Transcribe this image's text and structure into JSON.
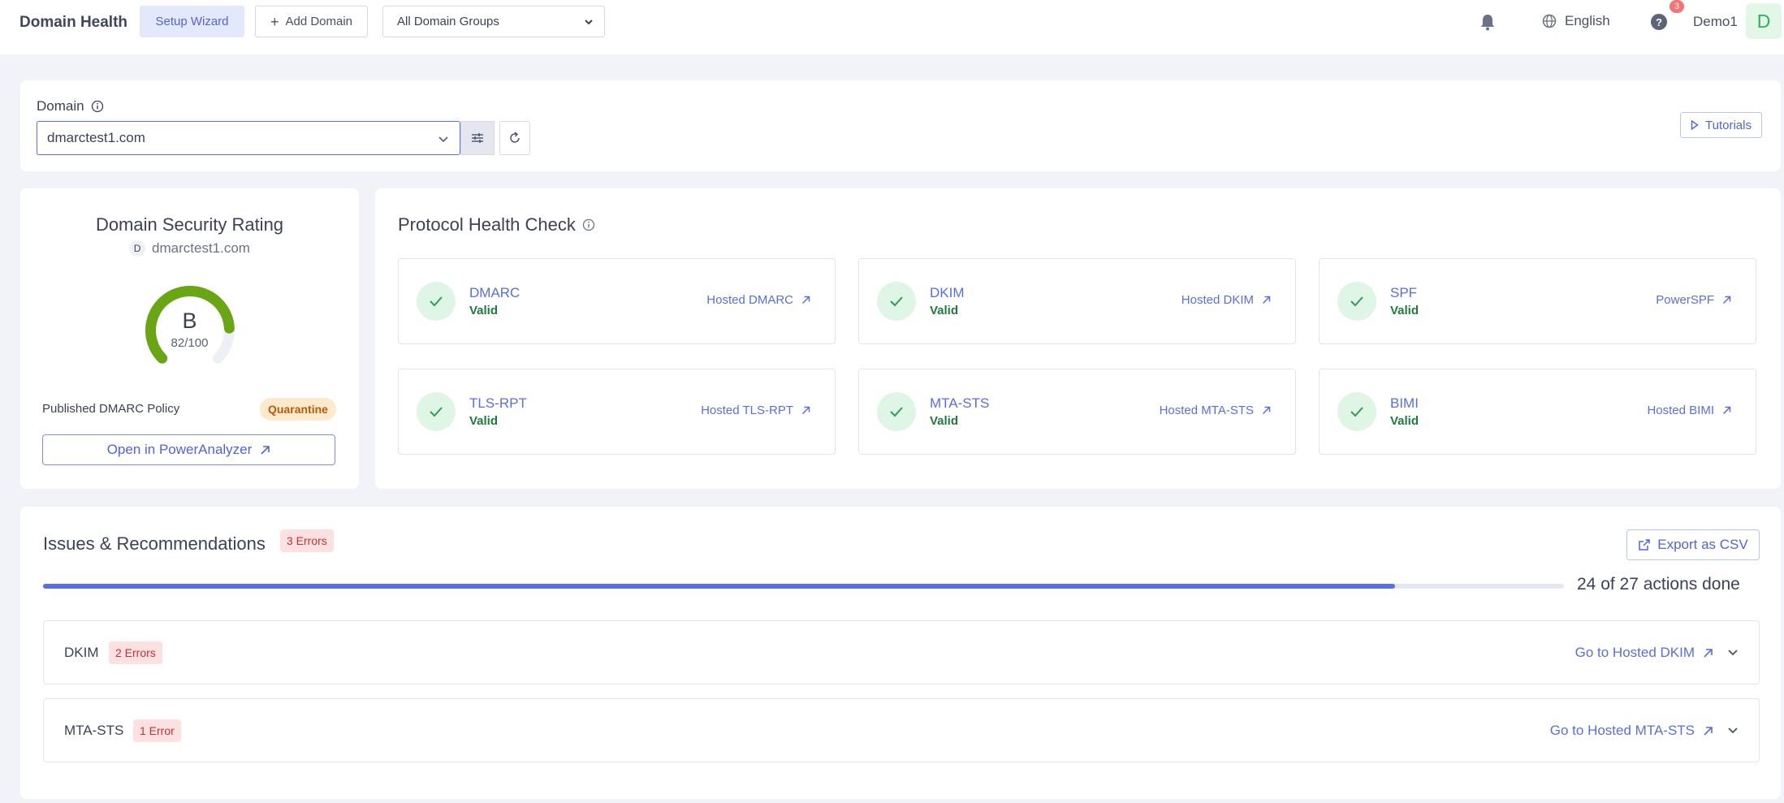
{
  "topbar": {
    "title": "Domain Health",
    "setup_wizard": "Setup Wizard",
    "add_domain": "Add Domain",
    "domain_group": "All Domain Groups",
    "language": "English",
    "help_badge": "3",
    "help_glyph": "?",
    "user_name": "Demo1",
    "avatar_letter": "D"
  },
  "domain_bar": {
    "label": "Domain",
    "value": "dmarctest1.com",
    "tutorials": "Tutorials"
  },
  "rating": {
    "title": "Domain Security Rating",
    "domain_chip": "D",
    "domain": "dmarctest1.com",
    "grade": "B",
    "score_text": "82/100",
    "score_value": 82,
    "score_max": 100,
    "policy_label": "Published DMARC Policy",
    "policy_value": "Quarantine",
    "open_button": "Open in PowerAnalyzer"
  },
  "protocol": {
    "title": "Protocol Health Check",
    "items": [
      {
        "name": "DMARC",
        "status": "Valid",
        "link": "Hosted DMARC"
      },
      {
        "name": "DKIM",
        "status": "Valid",
        "link": "Hosted DKIM"
      },
      {
        "name": "SPF",
        "status": "Valid",
        "link": "PowerSPF"
      },
      {
        "name": "TLS-RPT",
        "status": "Valid",
        "link": "Hosted TLS-RPT"
      },
      {
        "name": "MTA-STS",
        "status": "Valid",
        "link": "Hosted MTA-STS"
      },
      {
        "name": "BIMI",
        "status": "Valid",
        "link": "Hosted BIMI"
      }
    ]
  },
  "issues": {
    "title": "Issues & Recommendations",
    "error_badge": "3 Errors",
    "export": "Export as CSV",
    "progress_text": "24 of 27 actions done",
    "progress_done": 24,
    "progress_total": 27,
    "rows": [
      {
        "name": "DKIM",
        "badge": "2 Errors",
        "link": "Go to Hosted DKIM"
      },
      {
        "name": "MTA-STS",
        "badge": "1 Error",
        "link": "Go to Hosted MTA-STS"
      }
    ]
  },
  "colors": {
    "accent": "#5064d8",
    "gauge_green": "#6aa516",
    "valid_green": "#1f7a3d",
    "error_red": "#c0313a"
  }
}
